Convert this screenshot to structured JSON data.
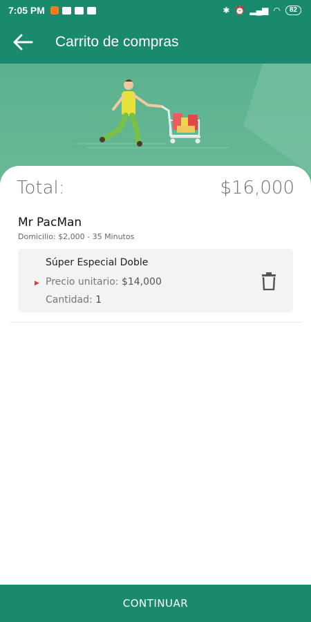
{
  "status_bar": {
    "time": "7:05 PM",
    "battery": "82",
    "icons": [
      "app-notification-icon",
      "youtube-icon",
      "mail-icon",
      "gallery-icon",
      "bluetooth-icon",
      "alarm-icon",
      "signal-icon",
      "wifi-icon"
    ]
  },
  "app_bar": {
    "title": "Carrito de compras",
    "back_icon": "arrow-back-icon"
  },
  "colors": {
    "primary": "#1a8a6e",
    "hero_bg": "#5ab28e",
    "shirt": "#e6e23a",
    "pants": "#78c04a"
  },
  "cart": {
    "total_label": "Total:",
    "total_value": "$16,000",
    "restaurant": "Mr PacMan",
    "delivery": "Domicilio: $2,000 - 35 Minutos",
    "items": [
      {
        "name": "Súper Especial Doble",
        "price_label": "Precio unitario:",
        "price": "$14,000",
        "qty_label": "Cantidad:",
        "qty": "1"
      }
    ]
  },
  "footer": {
    "continue_label": "CONTINUAR"
  }
}
